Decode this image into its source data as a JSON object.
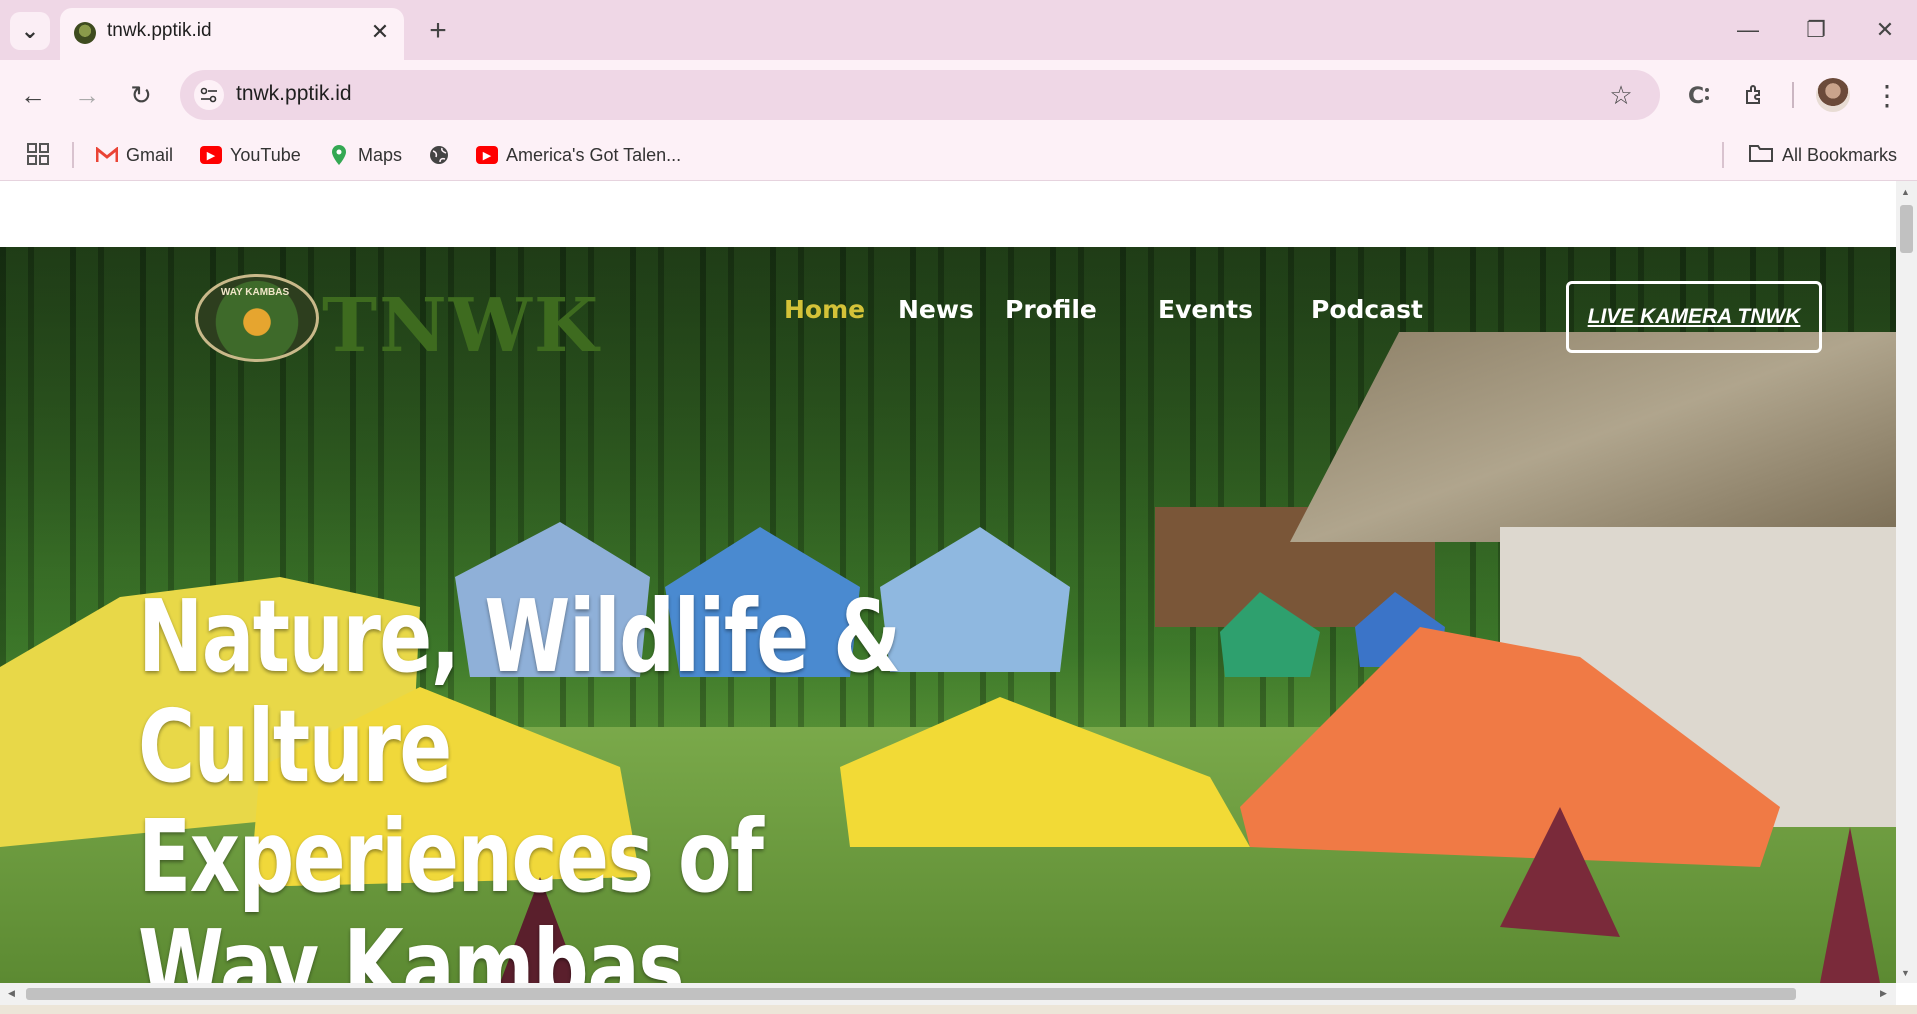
{
  "browser": {
    "tab": {
      "title": "tnwk.pptik.id",
      "close_glyph": "✕"
    },
    "new_tab_glyph": "+",
    "tab_list_glyph": "⌄",
    "window_controls": {
      "minimize": "—",
      "restore": "❐",
      "close": "✕"
    },
    "nav": {
      "back": "←",
      "forward": "→",
      "reload": "↻"
    },
    "url": "tnwk.pptik.id",
    "star_glyph": "☆",
    "bookmarks": [
      {
        "label": "Gmail",
        "icon": "gmail-icon",
        "color": "#ea4335"
      },
      {
        "label": "YouTube",
        "icon": "youtube-icon",
        "color": "#ff0000"
      },
      {
        "label": "Maps",
        "icon": "maps-icon",
        "color": "#34a853"
      },
      {
        "label": "",
        "icon": "globe-icon",
        "color": "#444444"
      },
      {
        "label": "America's Got Talen...",
        "icon": "youtube-icon",
        "color": "#ff0000"
      }
    ],
    "all_bookmarks": "All Bookmarks"
  },
  "site": {
    "logo_text": "WAY KAMBAS",
    "brand": "TNWK",
    "nav": [
      {
        "label": "Home",
        "active": true
      },
      {
        "label": "News",
        "active": false
      },
      {
        "label": "Profile",
        "active": false
      },
      {
        "label": "Events",
        "active": false
      },
      {
        "label": "Podcast",
        "active": false
      }
    ],
    "cta": "LIVE KAMERA TNWK",
    "hero_title": "Nature, Wildlife & Culture Experiences of Way Kambas",
    "colors": {
      "active_nav": "#d4c238",
      "brand": "#3e6b1f"
    }
  }
}
